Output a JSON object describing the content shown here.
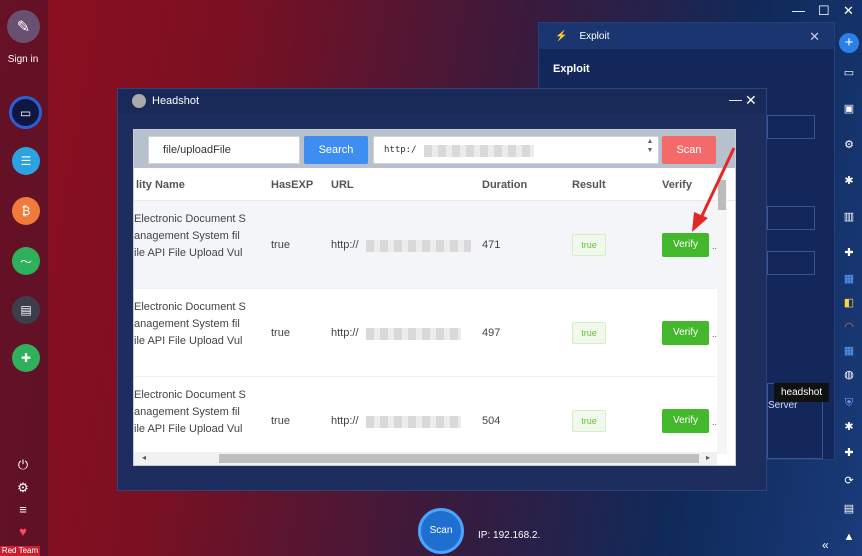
{
  "sidebar": {
    "signin_label": "Sign in",
    "brand_label": "Red Team"
  },
  "exploit_panel": {
    "tab_title": "Exploit",
    "heading": "Exploit",
    "partial_text": "Server"
  },
  "tooltip": "headshot",
  "headshot": {
    "title": "Headshot",
    "path_input": "file/uploadFile",
    "search_label": "Search",
    "url_input": "http:/",
    "scan_label": "Scan",
    "columns": [
      "lity Name",
      "HasEXP",
      "URL",
      "Duration",
      "Result",
      "Verify"
    ],
    "rows": [
      {
        "name_lines": [
          "Electronic Document S",
          "anagement System fil",
          "ile API File Upload Vul"
        ],
        "hasexp": "true",
        "url": "http://",
        "duration": "471",
        "result": "true",
        "verify": "Verify"
      },
      {
        "name_lines": [
          "Electronic Document S",
          "anagement System fil",
          "ile API File Upload Vul"
        ],
        "hasexp": "true",
        "url": "http://",
        "duration": "497",
        "result": "true",
        "verify": "Verify"
      },
      {
        "name_lines": [
          "Electronic Document S",
          "anagement System fil",
          "ile API File Upload Vul"
        ],
        "hasexp": "true",
        "url": "http://",
        "duration": "504",
        "result": "true",
        "verify": "Verify"
      }
    ]
  },
  "scan_button": "Scan",
  "ip_text": "IP: 192.168.2.",
  "colors": {
    "search": "#3d8ef0",
    "scan": "#f46a6a",
    "verify": "#44b82c",
    "arrow": "#e52626"
  }
}
